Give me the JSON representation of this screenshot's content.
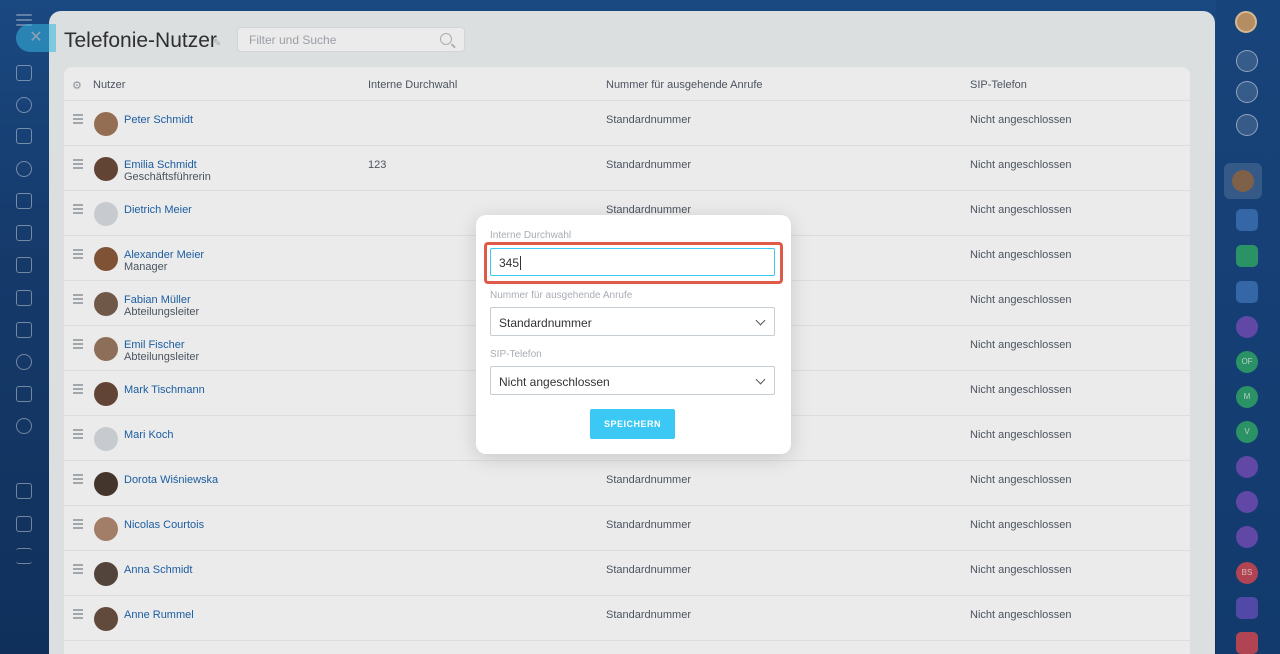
{
  "page": {
    "title": "Telefonie-Nutzer",
    "search_placeholder": "Filter und Suche"
  },
  "table": {
    "headers": [
      "Nutzer",
      "Interne Durchwahl",
      "Nummer für ausgehende Anrufe",
      "SIP-Telefon"
    ],
    "rows": [
      {
        "name": "Peter Schmidt",
        "position": "",
        "extension": "",
        "outgoing": "Standardnummer",
        "sip": "Nicht angeschlossen"
      },
      {
        "name": "Emilia Schmidt",
        "position": "Geschäftsführerin",
        "extension": "123",
        "outgoing": "Standardnummer",
        "sip": "Nicht angeschlossen"
      },
      {
        "name": "Dietrich Meier",
        "position": "",
        "extension": "",
        "outgoing": "Standardnummer",
        "sip": "Nicht angeschlossen"
      },
      {
        "name": "Alexander Meier",
        "position": "Manager",
        "extension": "",
        "outgoing": "",
        "sip": "Nicht angeschlossen"
      },
      {
        "name": "Fabian Müller",
        "position": "Abteilungsleiter",
        "extension": "",
        "outgoing": "",
        "sip": "Nicht angeschlossen"
      },
      {
        "name": "Emil Fischer",
        "position": "Abteilungsleiter",
        "extension": "",
        "outgoing": "",
        "sip": "Nicht angeschlossen"
      },
      {
        "name": "Mark Tischmann",
        "position": "",
        "extension": "",
        "outgoing": "",
        "sip": "Nicht angeschlossen"
      },
      {
        "name": "Mari Koch",
        "position": "",
        "extension": "",
        "outgoing": "",
        "sip": "Nicht angeschlossen"
      },
      {
        "name": "Dorota Wiśniewska",
        "position": "",
        "extension": "",
        "outgoing": "Standardnummer",
        "sip": "Nicht angeschlossen"
      },
      {
        "name": "Nicolas Courtois",
        "position": "",
        "extension": "",
        "outgoing": "Standardnummer",
        "sip": "Nicht angeschlossen"
      },
      {
        "name": "Anna Schmidt",
        "position": "",
        "extension": "",
        "outgoing": "Standardnummer",
        "sip": "Nicht angeschlossen"
      },
      {
        "name": "Anne Rummel",
        "position": "",
        "extension": "",
        "outgoing": "Standardnummer",
        "sip": "Nicht angeschlossen"
      }
    ]
  },
  "modal": {
    "ext_label": "Interne Durchwahl",
    "ext_value": "345",
    "outgoing_label": "Nummer für ausgehende Anrufe",
    "outgoing_value": "Standardnummer",
    "sip_label": "SIP-Telefon",
    "sip_value": "Nicht angeschlossen",
    "save_label": "SPEICHERN"
  },
  "right_rail": {
    "badges": [
      "OF",
      "M",
      "V",
      "BS"
    ]
  },
  "colors": {
    "accent": "#3bc8f5",
    "highlight": "#e05a4a",
    "link": "#2067b0",
    "background": "#1d4f8c"
  }
}
